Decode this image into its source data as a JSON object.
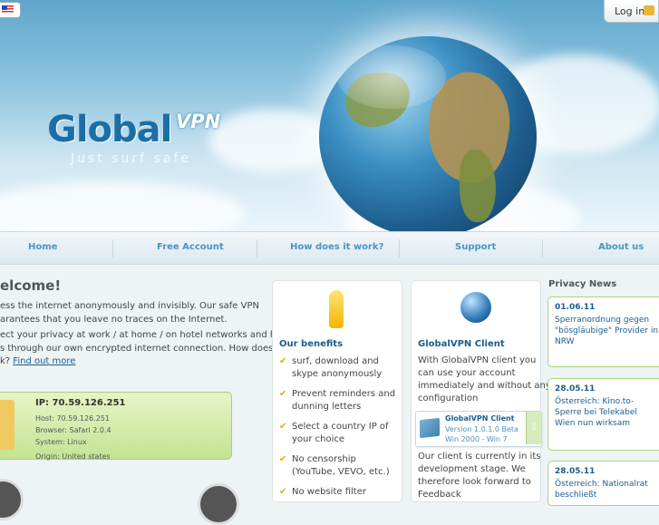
{
  "header": {
    "login_label": "Log in",
    "logo_main": "Global",
    "logo_vpn": "VPN",
    "tagline": "Just surf safe"
  },
  "nav": {
    "items": [
      "Home",
      "Free Account",
      "How does it work?",
      "Support",
      "About us"
    ]
  },
  "welcome": {
    "title": "elcome!",
    "p1_line1": "ess the internet anonymously and invisibly. Our safe VPN",
    "p1_line2": "arantees that you leave no traces on the Internet.",
    "p2_line1": "ect your privacy at work / at home / on hotel networks and hot",
    "p2_line2": "s through our own encrypted internet connection. How does this",
    "p2_line3": "k?",
    "find_out_more": "Find out more"
  },
  "ip_box": {
    "ip": "IP: 70.59.126.251",
    "host": "Host: 70.59.126.251",
    "browser": "Browser: Safari 2.0.4",
    "system": "System: Linux",
    "origin": "Origin: United states"
  },
  "benefits": {
    "title": "Our benefits",
    "items": [
      [
        "surf, download and",
        "skype anonymously"
      ],
      [
        "Prevent reminders and",
        "dunning letters"
      ],
      [
        "Select a country IP of",
        "your choice"
      ],
      [
        "No censorship",
        "(YouTube, VEVO, etc.)"
      ],
      [
        "No website filter",
        ""
      ]
    ]
  },
  "client_panel": {
    "title": "GlobalVPN Client",
    "desc": [
      "With GlobalVPN client you",
      "can use your account",
      "immediately and without any",
      "configuration"
    ],
    "download_title": "GlobalVPN Client",
    "download_version": "Version 1.0.1.0 Beta",
    "download_platform": "Win 2000 - Win 7",
    "note": [
      "Our client is currently in its",
      "development stage. We",
      "therefore look forward to",
      "Feedback"
    ]
  },
  "privacy_news": {
    "title": "Privacy News",
    "items": [
      {
        "date": "01.06.11",
        "lines": [
          "Sperranordnung gegen",
          "\"bösgläubige\" Provider in",
          "NRW"
        ]
      },
      {
        "date": "28.05.11",
        "lines": [
          "Österreich: Kino.to-",
          "Sperre bei Telekabel",
          "Wien nun wirksam"
        ]
      },
      {
        "date": "28.05.11",
        "lines": [
          "Österreich: Nationalrat",
          "beschließt"
        ]
      }
    ]
  },
  "colors": {
    "accent": "#1b5c8e",
    "nav_link": "#4b93c4",
    "news_border": "#a9d77d",
    "ip_box": "#c4e494"
  }
}
